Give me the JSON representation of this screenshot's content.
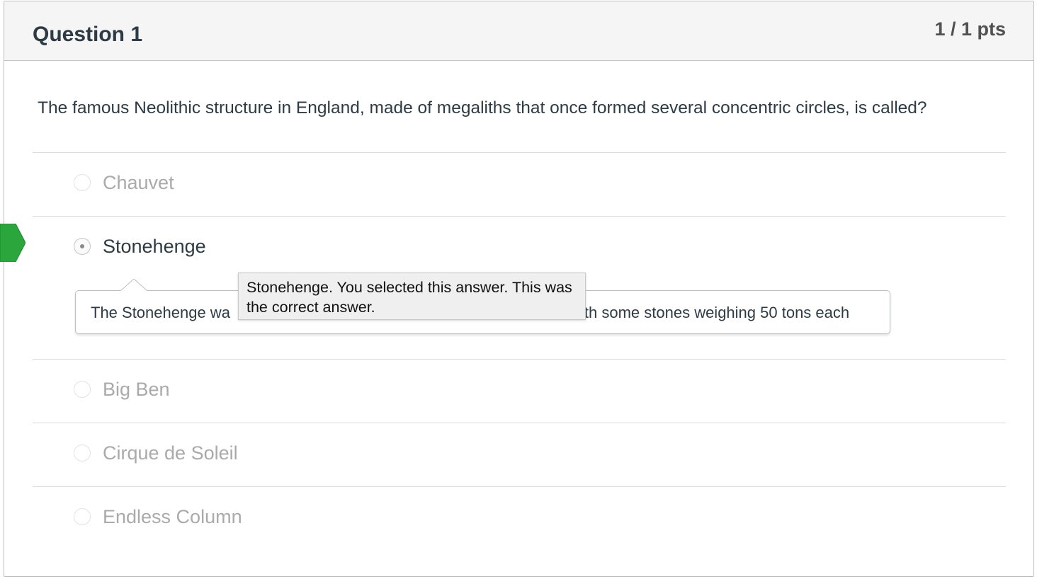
{
  "question": {
    "title": "Question 1",
    "points": "1 / 1 pts",
    "text": "The famous Neolithic structure in England, made of megaliths that once formed several concentric circles, is called?"
  },
  "answers": [
    {
      "label": "Chauvet",
      "selected": false
    },
    {
      "label": "Stonehenge",
      "selected": true,
      "correct": true
    },
    {
      "label": "Big Ben",
      "selected": false
    },
    {
      "label": "Cirque de Soleil",
      "selected": false
    },
    {
      "label": "Endless Column",
      "selected": false
    }
  ],
  "comment": {
    "text_left": "The Stonehenge wa",
    "text_right": "ith some stones weighing 50 tons each"
  },
  "tooltip": {
    "text": "Stonehenge. You selected this answer. This was the correct answer."
  },
  "colors": {
    "correct_flag": "#2aa63c",
    "header_bg": "#f5f5f5",
    "title_text": "#2d3b45",
    "unselected_text": "#aaaaaa"
  }
}
